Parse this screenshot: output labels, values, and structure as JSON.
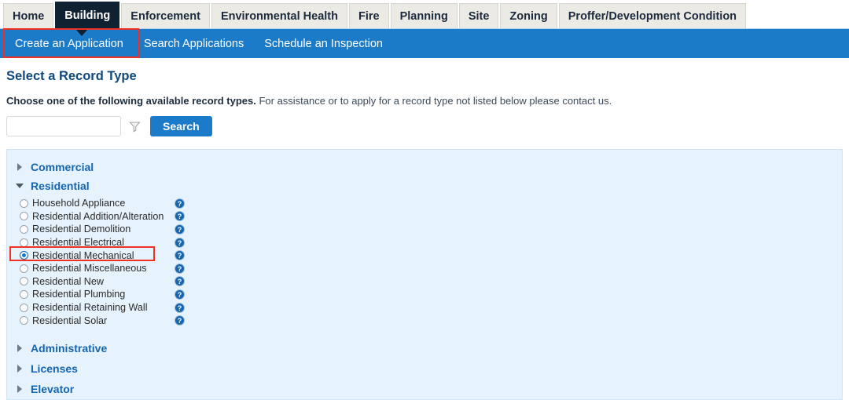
{
  "module_tabs": [
    {
      "label": "Home",
      "active": false
    },
    {
      "label": "Building",
      "active": true
    },
    {
      "label": "Enforcement",
      "active": false
    },
    {
      "label": "Environmental Health",
      "active": false
    },
    {
      "label": "Fire",
      "active": false
    },
    {
      "label": "Planning",
      "active": false
    },
    {
      "label": "Site",
      "active": false
    },
    {
      "label": "Zoning",
      "active": false
    },
    {
      "label": "Proffer/Development Condition",
      "active": false
    }
  ],
  "subnav": {
    "items": [
      {
        "label": "Create an Application",
        "active": true
      },
      {
        "label": "Search Applications",
        "active": false
      },
      {
        "label": "Schedule an Inspection",
        "active": false
      }
    ]
  },
  "main": {
    "page_title": "Select a Record Type",
    "instructions_bold": "Choose one of the following available record types.",
    "instructions_rest": " For assistance or to apply for a record type not listed below please contact us."
  },
  "search": {
    "value": "",
    "placeholder": "",
    "filter_icon": "funnel-icon",
    "button_label": "Search"
  },
  "record_types": {
    "groups": [
      {
        "label": "Commercial",
        "expanded": false,
        "items": []
      },
      {
        "label": "Residential",
        "expanded": true,
        "items": [
          {
            "label": "Household Appliance",
            "selected": false,
            "help": "help-icon"
          },
          {
            "label": "Residential Addition/Alteration",
            "selected": false,
            "help": "help-icon"
          },
          {
            "label": "Residential Demolition",
            "selected": false,
            "help": "help-icon"
          },
          {
            "label": "Residential Electrical",
            "selected": false,
            "help": "help-icon"
          },
          {
            "label": "Residential Mechanical",
            "selected": true,
            "help": "help-icon"
          },
          {
            "label": "Residential Miscellaneous",
            "selected": false,
            "help": "help-icon"
          },
          {
            "label": "Residential New",
            "selected": false,
            "help": "help-icon"
          },
          {
            "label": "Residential Plumbing",
            "selected": false,
            "help": "help-icon"
          },
          {
            "label": "Residential Retaining Wall",
            "selected": false,
            "help": "help-icon"
          },
          {
            "label": "Residential Solar",
            "selected": false,
            "help": "help-icon"
          }
        ]
      },
      {
        "label": "Administrative",
        "expanded": false,
        "items": []
      },
      {
        "label": "Licenses",
        "expanded": false,
        "items": []
      },
      {
        "label": "Elevator",
        "expanded": false,
        "items": []
      }
    ]
  },
  "annotations": {
    "highlight_color": "#ee3124",
    "targets": [
      "Create an Application",
      "Residential Mechanical"
    ]
  },
  "colors": {
    "active_tab": "#102132",
    "subnav_blue": "#1c7bc9",
    "panel_blue": "#e6f3fc",
    "link_blue": "#1565b0",
    "title_blue": "#11497d"
  }
}
